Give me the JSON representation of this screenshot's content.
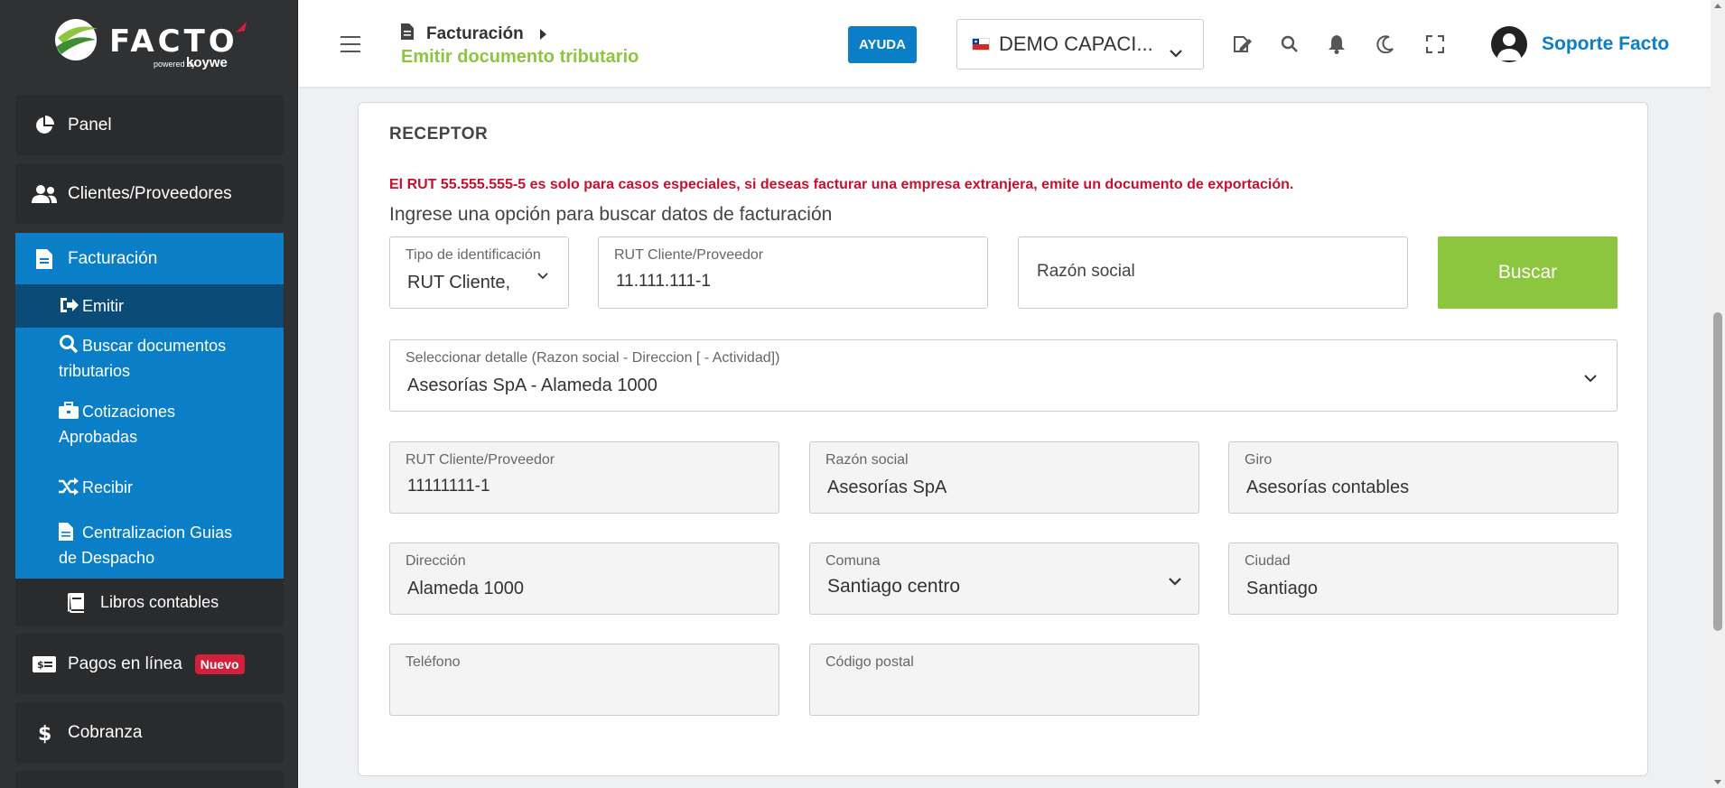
{
  "sidebar": {
    "logo": {
      "word": "FACTO",
      "powered": "powered by",
      "koywe": "koywe"
    },
    "items": [
      {
        "label": "Panel",
        "icon": "pie-chart-icon"
      },
      {
        "label": "Clientes/Proveedores",
        "icon": "users-icon"
      },
      {
        "label": "Facturación",
        "icon": "document-icon"
      },
      {
        "label": "Pagos en línea",
        "icon": "money-bill-icon",
        "badge": "Nuevo"
      },
      {
        "label": "Cobranza",
        "icon": "dollar-icon"
      }
    ],
    "facturacion_sub": [
      {
        "label": "Emitir",
        "icon": "sign-out-icon"
      },
      {
        "label": "Buscar documentos",
        "label2": "tributarios",
        "icon": "search-icon"
      },
      {
        "label": "Cotizaciones",
        "label2": "Aprobadas",
        "icon": "briefcase-icon"
      },
      {
        "label": "Recibir",
        "icon": "shuffle-icon"
      },
      {
        "label": "Centralizacion Guias",
        "label2": "de Despacho",
        "icon": "document-icon"
      }
    ],
    "libros": {
      "label": "Libros contables",
      "icon": "book-icon"
    }
  },
  "header": {
    "breadcrumb": "Facturación",
    "subtitle": "Emitir documento tributario",
    "ayuda": "AYUDA",
    "company": "DEMO CAPACI...",
    "user_name": "Soporte Facto"
  },
  "receptor": {
    "title": "RECEPTOR",
    "warning": "El RUT 55.555.555-5 es solo para casos especiales, si deseas facturar una empresa extranjera, emite un documento de exportación.",
    "hint": "Ingrese una opción para buscar datos de facturación",
    "tipo_id": {
      "label": "Tipo de identificación",
      "value": "RUT Cliente,"
    },
    "rut_search": {
      "label": "RUT Cliente/Proveedor",
      "value": "11.111.111-1"
    },
    "razon_search": {
      "label": "Razón social"
    },
    "buscar": "Buscar",
    "detalle": {
      "label": "Seleccionar detalle (Razon social - Direccion [ - Actividad])",
      "value": "Asesorías SpA - Alameda 1000"
    },
    "rut": {
      "label": "RUT Cliente/Proveedor",
      "value": "11111111-1"
    },
    "razon": {
      "label": "Razón social",
      "value": "Asesorías SpA"
    },
    "giro": {
      "label": "Giro",
      "value": "Asesorías contables"
    },
    "direccion": {
      "label": "Dirección",
      "value": "Alameda 1000"
    },
    "comuna": {
      "label": "Comuna",
      "value": "Santiago centro"
    },
    "ciudad": {
      "label": "Ciudad",
      "value": "Santiago"
    },
    "telefono": {
      "label": "Teléfono",
      "value": ""
    },
    "postal": {
      "label": "Código postal",
      "value": ""
    }
  },
  "colors": {
    "primary": "#0a7fc7",
    "accent": "#8cc63f",
    "danger": "#c8102e",
    "sidebar": "#2f3133"
  }
}
